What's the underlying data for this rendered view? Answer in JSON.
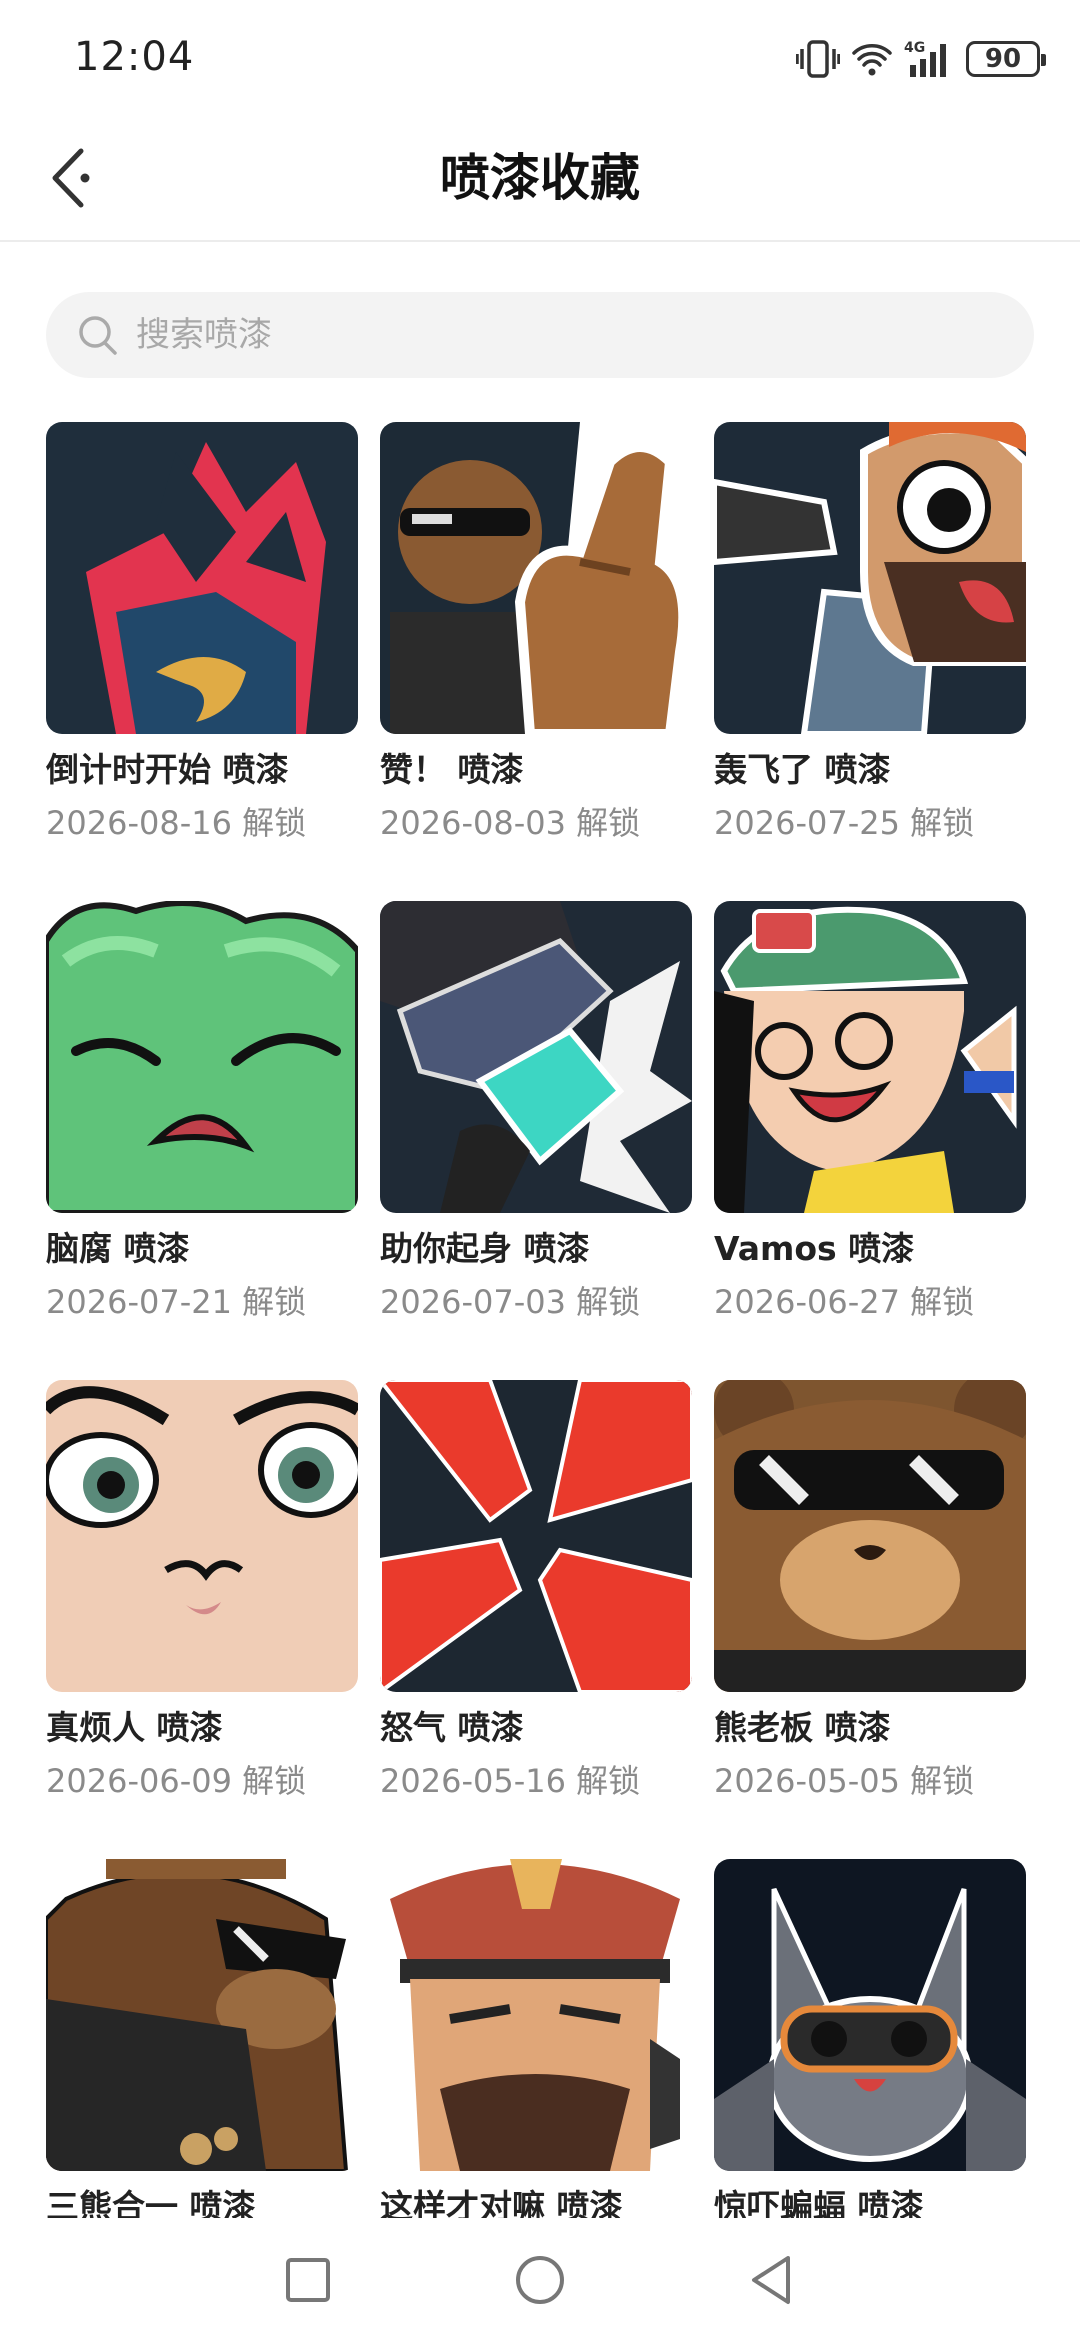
{
  "status_bar": {
    "time": "12:04",
    "battery": "90",
    "network": "4G"
  },
  "header": {
    "title": "喷漆收藏",
    "back_icon": "back-arrow-icon"
  },
  "search": {
    "placeholder": "搜索喷漆"
  },
  "sprays": [
    {
      "title": "倒计时开始 喷漆",
      "date": "2026-08-16 解锁"
    },
    {
      "title": "赞！ 喷漆",
      "date": "2026-08-03 解锁"
    },
    {
      "title": "轰飞了 喷漆",
      "date": "2026-07-25 解锁"
    },
    {
      "title": "脑腐 喷漆",
      "date": "2026-07-21 解锁"
    },
    {
      "title": "助你起身 喷漆",
      "date": "2026-07-03 解锁"
    },
    {
      "title": "Vamos 喷漆",
      "date": "2026-06-27 解锁"
    },
    {
      "title": "真烦人 喷漆",
      "date": "2026-06-09 解锁"
    },
    {
      "title": "怒气 喷漆",
      "date": "2026-05-16 解锁"
    },
    {
      "title": "熊老板 喷漆",
      "date": "2026-05-05 解锁"
    },
    {
      "title": "三熊合一 喷漆",
      "date": ""
    },
    {
      "title": "这样才对嘛 喷漆",
      "date": ""
    },
    {
      "title": "惊吓蝙蝠 喷漆",
      "date": ""
    }
  ],
  "nav": {
    "recent_icon": "square-icon",
    "home_icon": "circle-icon",
    "back_icon": "triangle-back-icon"
  }
}
